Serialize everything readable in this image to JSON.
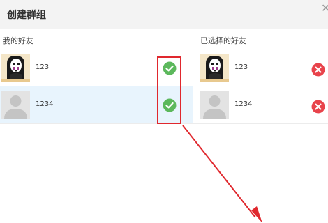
{
  "dialog": {
    "title": "创建群组",
    "close_glyph": "✕"
  },
  "left_panel": {
    "label": "我的好友",
    "friends": [
      {
        "name": "123",
        "avatar": "anime-avatar",
        "selected": true
      },
      {
        "name": "1234",
        "avatar": "default-avatar",
        "selected": true
      }
    ]
  },
  "right_panel": {
    "label": "已选择的好友",
    "selected": [
      {
        "name": "123",
        "avatar": "anime-avatar"
      },
      {
        "name": "1234",
        "avatar": "default-avatar"
      }
    ]
  },
  "colors": {
    "check_green": "#5cb85c",
    "remove_red": "#e8434b",
    "annotation_red": "#e0282e",
    "selected_row_bg": "#e8f4fd"
  }
}
